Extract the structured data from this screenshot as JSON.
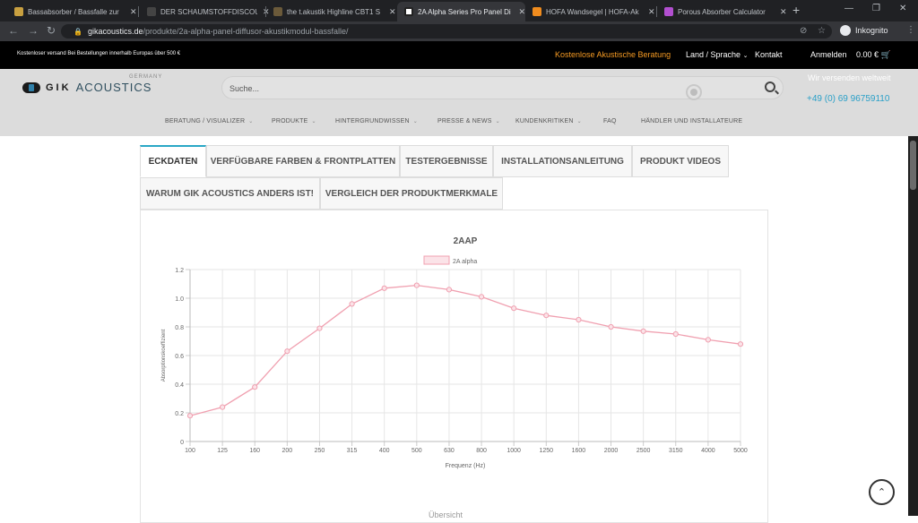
{
  "browser": {
    "tabs": [
      {
        "title": "Bassabsorber / Bassfalle zur",
        "favicon_color": "#c8a040",
        "active": false
      },
      {
        "title": "DER SCHAUMSTOFFDISCOUNT",
        "favicon_color": "#444444",
        "active": false
      },
      {
        "title": "the t.akustik Highline CBT1 S",
        "favicon_color": "#6b5a3a",
        "active": false
      },
      {
        "title": "2A Alpha Series Pro Panel Di",
        "favicon_color": "#ffffff",
        "active": true
      },
      {
        "title": "HOFA Wandsegel | HOFA-Ak",
        "favicon_color": "#f08c1e",
        "active": false
      },
      {
        "title": "Porous Absorber Calculator",
        "favicon_color": "#b24fd0",
        "active": false
      }
    ],
    "url_domain": "gikacoustics.de",
    "url_path": "/produkte/2a-alpha-panel-diffusor-akustikmodul-bassfalle/",
    "profile": "Inkognito"
  },
  "topbar": {
    "shipping_note": "Kostenloser versand Bei Bestellungen innerhalb Europas über 500 €",
    "advice": "Kostenlose Akustische Beratung",
    "country": "Land / Sprache",
    "contact": "Kontakt",
    "login": "Anmelden",
    "cart": "0.00 €"
  },
  "header": {
    "logo_gik": "GIK",
    "logo_acoustics": "ACOUSTICS",
    "logo_germany": "GERMANY",
    "search_placeholder": "Suche...",
    "ship_world": "Wir versenden weltweit",
    "phone": "+49 (0) 69 96759110",
    "nav": [
      {
        "label": "BERATUNG / VISUALIZER",
        "dropdown": true
      },
      {
        "label": "PRODUKTE",
        "dropdown": true
      },
      {
        "label": "HINTERGRUNDWISSEN",
        "dropdown": true
      },
      {
        "label": "PRESSE & NEWS",
        "dropdown": true
      },
      {
        "label": "KUNDENKRITIKEN",
        "dropdown": true
      },
      {
        "label": "FAQ",
        "dropdown": false
      },
      {
        "label": "HÄNDLER UND INSTALLATEURE",
        "dropdown": false
      }
    ]
  },
  "product_tabs": [
    "ECKDATEN",
    "VERFÜGBARE FARBEN & FRONTPLATTEN",
    "TESTERGEBNISSE",
    "INSTALLATIONSANLEITUNG",
    "PRODUKT VIDEOS",
    "WARUM GIK ACOUSTICS ANDERS IST!",
    "VERGLEICH DER PRODUKTMERKMALE"
  ],
  "active_tab": "ECKDATEN",
  "chart_data": {
    "type": "line",
    "title": "2AAP",
    "xlabel": "Frequenz (Hz)",
    "ylabel": "Absorptionskoeffizient",
    "categories": [
      "100",
      "125",
      "160",
      "200",
      "250",
      "315",
      "400",
      "500",
      "630",
      "800",
      "1000",
      "1250",
      "1600",
      "2000",
      "2500",
      "3150",
      "4000",
      "5000"
    ],
    "series": [
      {
        "name": "2A alpha",
        "color": "#f0a0b0",
        "values": [
          0.18,
          0.24,
          0.38,
          0.63,
          0.79,
          0.96,
          1.07,
          1.09,
          1.06,
          1.01,
          0.93,
          0.88,
          0.85,
          0.8,
          0.77,
          0.75,
          0.71,
          0.68
        ]
      }
    ],
    "ylim": [
      0,
      1.2
    ],
    "yticks": [
      "0",
      "0.2",
      "0.4",
      "0.6",
      "0.8",
      "1.0",
      "1.2"
    ],
    "grid": true,
    "legend": "top-center"
  },
  "footer_partial": "Übersicht"
}
